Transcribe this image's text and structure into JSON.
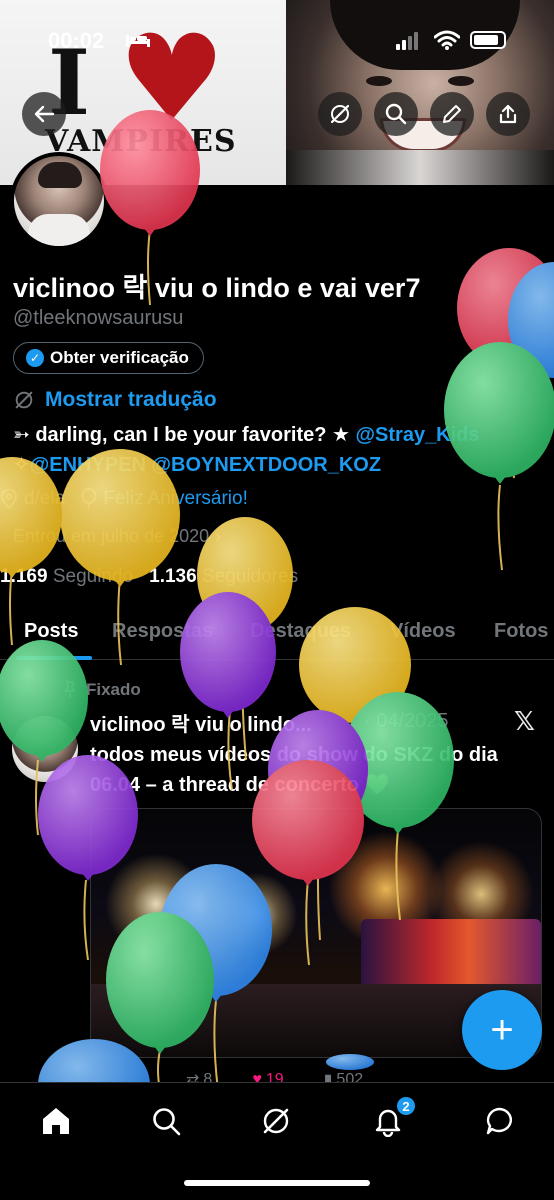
{
  "status_bar": {
    "time": "00:02"
  },
  "banner": {
    "left_text_top": "I",
    "left_text_bottom": "VAMPIRES"
  },
  "profile": {
    "display_name": "viclinoo 락 viu o lindo e vai ver7",
    "handle": "@tleeknowsaurusu",
    "verify_button": "Obter verificação",
    "translate_link": "Mostrar tradução",
    "bio_line1_prefix": "➳ darling, can I be your favorite? ★ ",
    "bio_mention1": "@Stray_Kids",
    "bio_line2_prefix": "✧",
    "bio_mention2": "@ENHYPEN",
    "bio_mention3": "@BOYNEXTDOOR_KOZ",
    "location": "d/ela",
    "birthday_link": "Feliz Aniversário!",
    "joined": "Entrou em julho de 2020",
    "following_count": "1.169",
    "following_label": "Seguindo",
    "followers_count": "1.136",
    "followers_label": "Seguidores"
  },
  "tabs": [
    "Posts",
    "Respostas",
    "Destaques",
    "Vídeos",
    "Fotos"
  ],
  "pinned_post": {
    "pinned_label": "Fixado",
    "author": "viclinoo 락 viu o lindo...",
    "date": "· 04/2025",
    "text": "todos meus vídeos do show do SKZ do dia 06.04 – a thread de concerto 💚",
    "reposts": "8",
    "likes": "19",
    "views": "502"
  },
  "notifications_badge": "2",
  "colors": {
    "accent": "#1d9bf0",
    "like": "#f91880",
    "background": "#000000",
    "muted": "#71767b"
  },
  "icons": [
    "back-arrow-icon",
    "grok-icon",
    "search-icon",
    "edit-pencil-icon",
    "share-icon",
    "home-icon",
    "notifications-bell-icon",
    "messages-icon",
    "pin-icon",
    "location-icon",
    "balloon-icon",
    "calendar-icon",
    "x-logo-icon",
    "plus-icon"
  ]
}
